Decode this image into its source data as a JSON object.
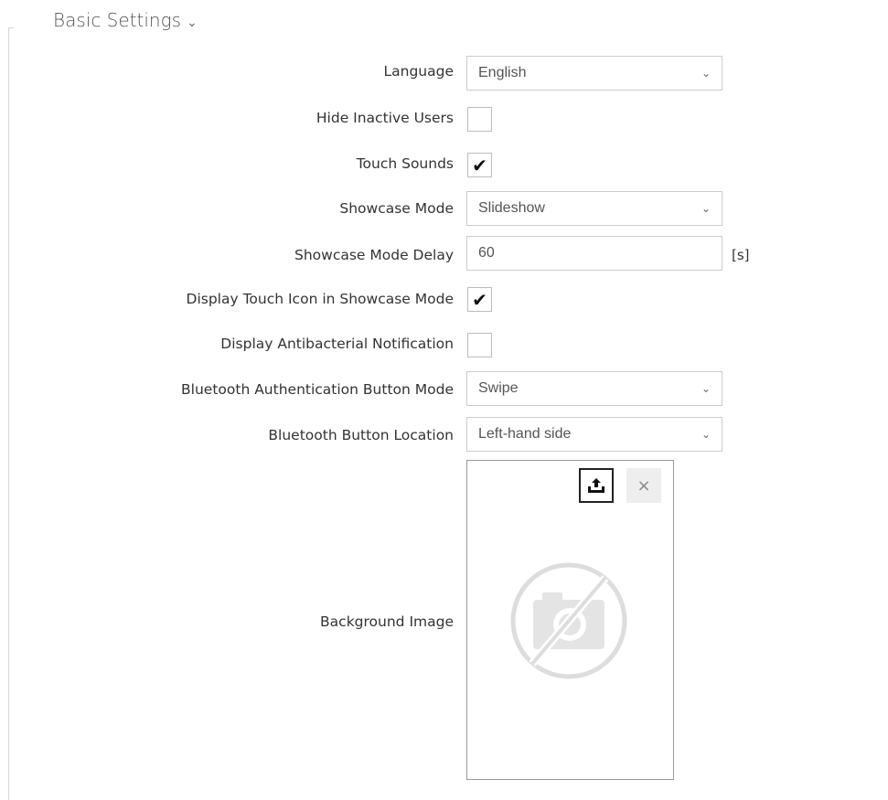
{
  "section": {
    "title": "Basic Settings",
    "chevron": "›"
  },
  "fields": {
    "language": {
      "label": "Language",
      "value": "English"
    },
    "hide_inactive_users": {
      "label": "Hide Inactive Users",
      "checked": false
    },
    "touch_sounds": {
      "label": "Touch Sounds",
      "checked": true,
      "mark": "✔"
    },
    "showcase_mode": {
      "label": "Showcase Mode",
      "value": "Slideshow"
    },
    "showcase_mode_delay": {
      "label": "Showcase Mode Delay",
      "value": "60",
      "unit": "[s]"
    },
    "display_touch_icon": {
      "label": "Display Touch Icon in Showcase Mode",
      "checked": true,
      "mark": "✔"
    },
    "display_antibacterial": {
      "label": "Display Antibacterial Notification",
      "checked": false
    },
    "bt_auth_button_mode": {
      "label": "Bluetooth Authentication Button Mode",
      "value": "Swipe"
    },
    "bt_button_location": {
      "label": "Bluetooth Button Location",
      "value": "Left-hand side"
    },
    "background_image": {
      "label": "Background Image",
      "remove_glyph": "×"
    }
  },
  "icons": {
    "dropdown": "chevron-down-icon",
    "upload": "upload-icon",
    "remove": "close-icon",
    "placeholder": "no-image-camera-icon"
  },
  "colors": {
    "border": "#cccccc",
    "text": "#333333",
    "placeholder": "#dddddd"
  }
}
